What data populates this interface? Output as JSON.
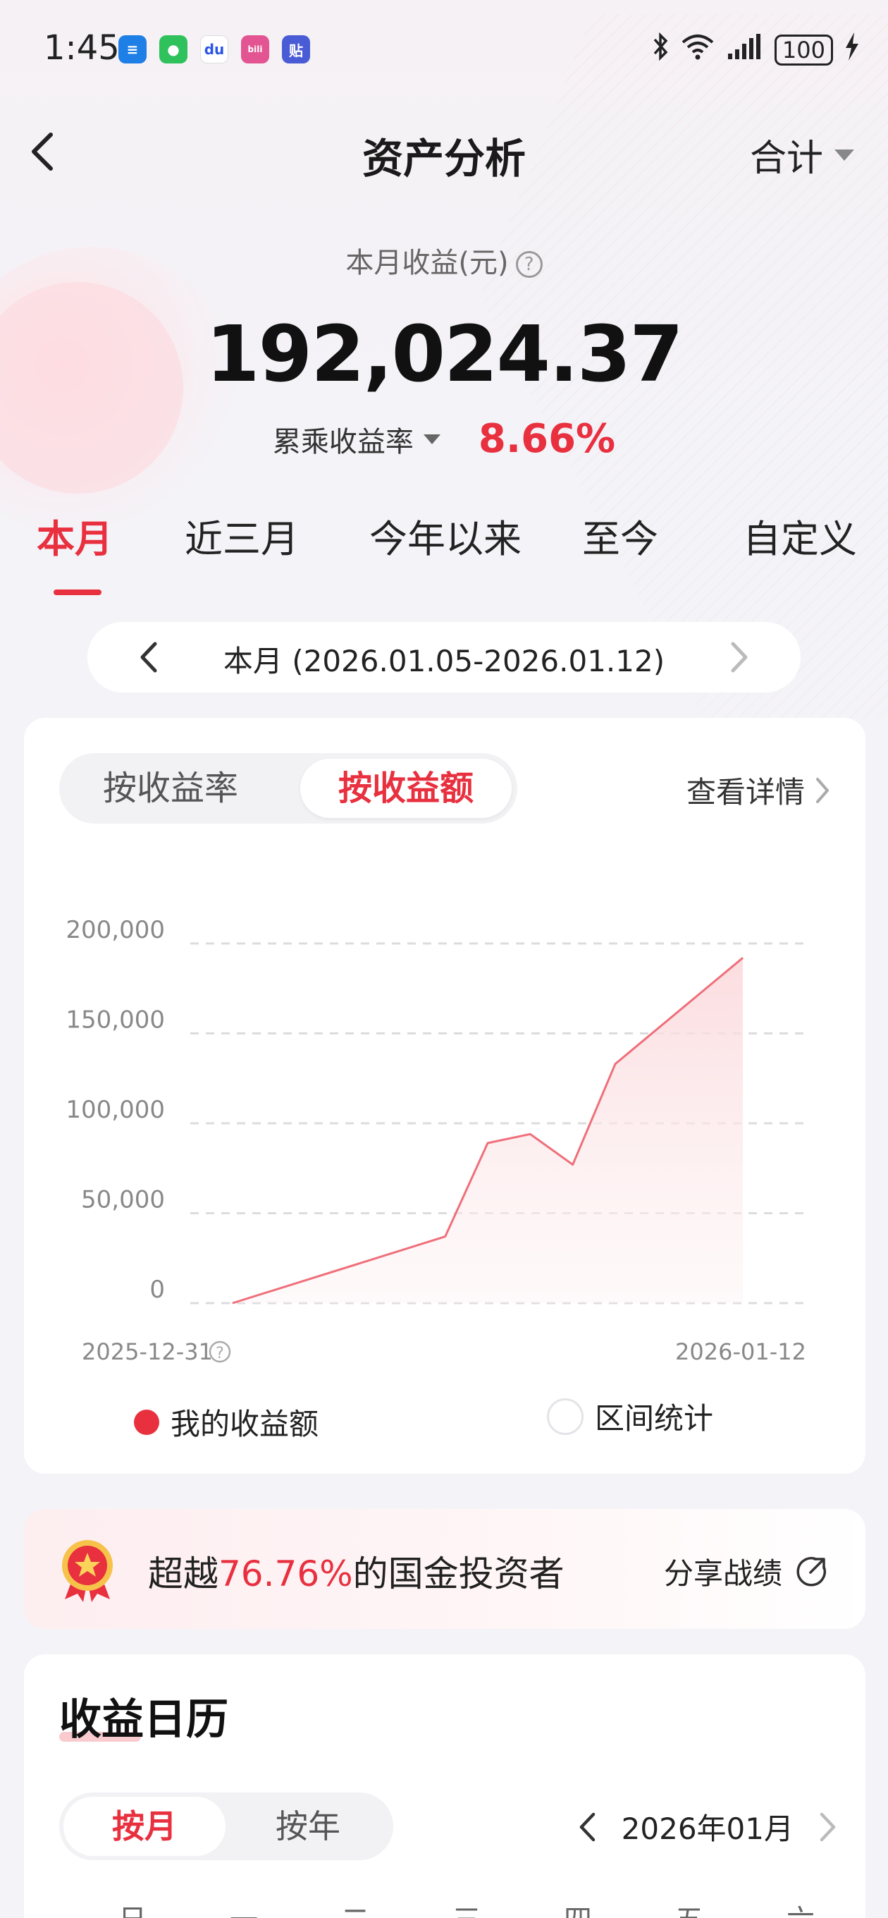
{
  "status": {
    "time": "1:45",
    "battery": "100",
    "apps": [
      {
        "name": "message-app-icon",
        "color": "#1e7fe6",
        "glyph": "≡"
      },
      {
        "name": "wechat-app-icon",
        "color": "#2ec15c",
        "glyph": "●"
      },
      {
        "name": "baidu-app-icon",
        "color": "#ffffff",
        "glyph": "du"
      },
      {
        "name": "bilibili-app-icon",
        "color": "#e25592",
        "glyph": "bili"
      },
      {
        "name": "tieba-app-icon",
        "color": "#4a5bd6",
        "glyph": "贴"
      }
    ]
  },
  "header": {
    "title": "资产分析",
    "total_label": "合计"
  },
  "summary": {
    "earnings_label": "本月收益(元)",
    "earnings_value": "192,024.37",
    "rate_label": "累乘收益率",
    "rate_value": "8.66%"
  },
  "period_tabs": [
    "本月",
    "近三月",
    "今年以来",
    "至今",
    "自定义"
  ],
  "date_range": "本月 (2026.01.05-2026.01.12)",
  "chart_card": {
    "segment": [
      "按收益率",
      "按收益额"
    ],
    "detail_label": "查看详情",
    "start_date": "2025-12-31",
    "end_date": "2026-01-12",
    "legend_mine": "我的收益额",
    "legend_interval": "区间统计"
  },
  "chart_data": {
    "type": "area",
    "title": "",
    "xlabel": "",
    "ylabel": "",
    "ylim": [
      0,
      200000
    ],
    "y_ticks": [
      "200,000",
      "150,000",
      "100,000",
      "50,000",
      "0"
    ],
    "y_tick_values": [
      200000,
      150000,
      100000,
      50000,
      0
    ],
    "x": [
      "2025-12-31",
      "2026-01-05",
      "2026-01-06",
      "2026-01-07",
      "2026-01-08",
      "2026-01-09",
      "2026-01-12"
    ],
    "series": [
      {
        "name": "我的收益额",
        "color": "#ef6f7a",
        "values": [
          0,
          37000,
          89000,
          94000,
          77000,
          133000,
          192024.37
        ]
      }
    ],
    "grid": true,
    "legend_placement": "bottom"
  },
  "rank": {
    "prefix": "超越",
    "percent": "76.76%",
    "suffix": "的国金投资者",
    "share_label": "分享战绩"
  },
  "calendar": {
    "title": "收益日历",
    "segment": [
      "按月",
      "按年"
    ],
    "month": "2026年01月",
    "weekdays": [
      "日",
      "一",
      "二",
      "三",
      "四",
      "五",
      "六"
    ]
  },
  "colors": {
    "accent": "#e8303f",
    "line": "#ef6f7a"
  }
}
